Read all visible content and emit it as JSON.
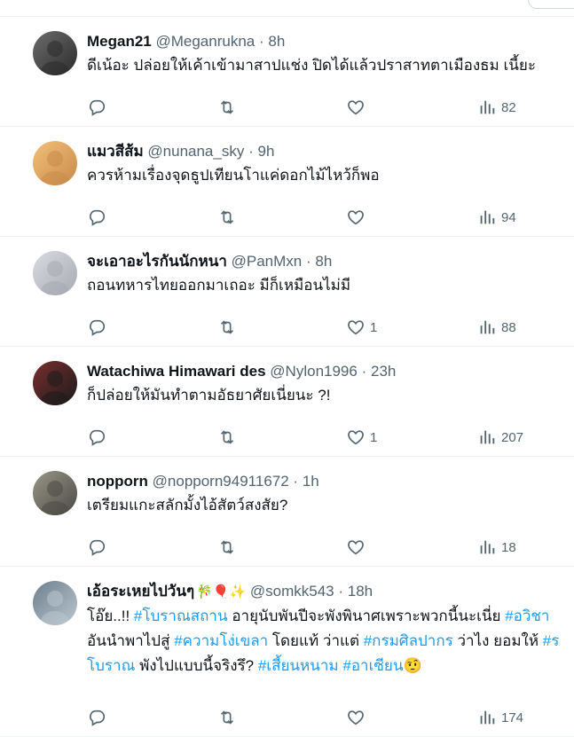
{
  "tweets": [
    {
      "name": "Megan21",
      "handle": "@Meganrukna",
      "time": "8h",
      "text_lines": [
        [
          {
            "t": "ดีเน้อะ ปล่อยให้เค้าเข้ามาสาปแช่ง ปิดได้แล้วปราสาทตาเมืองธม เนี้ยะ"
          }
        ]
      ],
      "likes": "",
      "views": "82"
    },
    {
      "name": "แมวสีส้ม",
      "handle": "@nunana_sky",
      "time": "9h",
      "text_lines": [
        [
          {
            "t": "ควรห้ามเรื่องจุดธูปเทียนโาแค่ดอกไม้ไหว้ก็พอ"
          }
        ]
      ],
      "likes": "",
      "views": "94"
    },
    {
      "name": "จะเอาอะไรกันนักหนา",
      "handle": "@PanMxn",
      "time": "8h",
      "text_lines": [
        [
          {
            "t": "ถอนทหารไทยออกมาเถอะ มีก็เหมือนไม่มี"
          }
        ]
      ],
      "likes": "1",
      "views": "88"
    },
    {
      "name": "Watachiwa Himawari des",
      "handle": "@Nylon1996",
      "time": "23h",
      "text_lines": [
        [
          {
            "t": "ก็ปล่อยให้มันทำตามอัธยาศัยเนี่ยนะ ?!"
          }
        ]
      ],
      "likes": "1",
      "views": "207"
    },
    {
      "name": "nopporn",
      "handle": "@nopporn94911672",
      "time": "1h",
      "text_lines": [
        [
          {
            "t": "เตรียมแกะสลักมั้งไอ้สัตว์สงสัย?"
          }
        ]
      ],
      "likes": "",
      "views": "18"
    },
    {
      "name": "เอ้อระเหยไปวันๆ",
      "emoji": "🎋🎈✨",
      "handle": "@somkk543",
      "time": "18h",
      "text_lines": [
        [
          {
            "t": "โอ๊ย..!! "
          },
          {
            "t": "#โบราณสถาน",
            "tag": true
          },
          {
            "t": " อายุนับพันปีจะพังพินาศเพราะพวกนี้นะเนี่ย "
          },
          {
            "t": "#อวิชา",
            "tag": true
          }
        ],
        [
          {
            "t": "อันนำพาไปสู่ "
          },
          {
            "t": "#ความโง่เขลา",
            "tag": true
          },
          {
            "t": " โดยแท้ ว่าแต่ "
          },
          {
            "t": "#กรมศิลปากร",
            "tag": true
          },
          {
            "t": " ว่าไง ยอมให้ "
          },
          {
            "t": "#ร",
            "tag": true
          }
        ],
        [
          {
            "t": "โบราณ",
            "tag": true
          },
          {
            "t": " พังไปแบบนี้จริงรึ? "
          },
          {
            "t": "#เสี้ยนหนาม",
            "tag": true
          },
          {
            "t": " "
          },
          {
            "t": "#อาเซียน",
            "tag": true
          },
          {
            "t": "🤨"
          }
        ]
      ],
      "likes": "",
      "views": "174"
    }
  ],
  "icons": {
    "reply": "reply-icon",
    "retweet": "retweet-icon",
    "like": "like-icon",
    "views": "views-icon"
  },
  "colors": {
    "accent": "#1d9bf0",
    "secondary": "#536471",
    "divider": "#eff3f4"
  }
}
